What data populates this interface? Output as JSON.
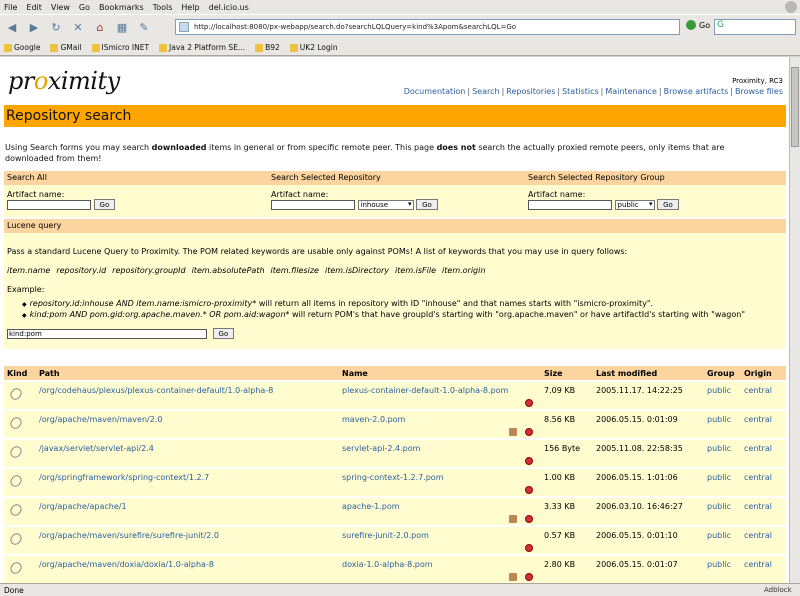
{
  "browser": {
    "menu": [
      "File",
      "Edit",
      "View",
      "Go",
      "Bookmarks",
      "Tools",
      "Help",
      "del.icio.us"
    ],
    "url": "http://localhost:8080/px-webapp/search.do?searchLQLQuery=kind%3Apom&searchLQL=Go",
    "go_label": "Go",
    "search_value": "G",
    "bookmarks": [
      "Google",
      "GMail",
      "ISmicro INET",
      "Java 2 Platform SE...",
      "B92",
      "UK2 Login"
    ],
    "status": "Done",
    "adblock": "Adblock"
  },
  "header": {
    "logo": "proximity",
    "version": "Proximity, RC3",
    "nav": [
      "Documentation",
      "Search",
      "Repositories",
      "Statistics",
      "Maintenance",
      "Browse artifacts",
      "Browse files"
    ]
  },
  "page": {
    "title": "Repository search",
    "intro_parts": [
      "Using Search forms you may search ",
      "downloaded",
      " items in general or from specific remote peer. This page ",
      "does not",
      " search the actually proxied remote peers, only items that are downloaded from them!"
    ]
  },
  "search_all": {
    "head": "Search All",
    "label": "Artifact name:",
    "button": "Go"
  },
  "search_repo": {
    "head": "Search Selected Repository",
    "label": "Artifact name:",
    "select": "inhouse",
    "button": "Go"
  },
  "search_group": {
    "head": "Search Selected Repository Group",
    "label": "Artifact name:",
    "select": "public",
    "button": "Go"
  },
  "lucene": {
    "head": "Lucene query",
    "description": "Pass a standard Lucene Query to Proximity. The POM related keywords are usable only against POMs! A list of keywords that you may use in query follows:",
    "keywords": [
      "item.name",
      "repository.id",
      "repository.groupId",
      "item.absolutePath",
      "item.filesize",
      "item.isDirectory",
      "item.isFile",
      "item.origin"
    ],
    "example_label": "Example:",
    "examples": [
      {
        "query": "repository.id:inhouse AND item.name:ismicro-proximity*",
        "desc": " will return all items in repository with ID \"inhouse\" and that names starts with \"ismicro-proximity\"."
      },
      {
        "query": "kind:pom AND pom.gid:org.apache.maven.* OR pom.aid:wagon*",
        "desc": " will return POM's that have groupId's starting with \"org.apache.maven\" or have artifactId's starting with \"wagon\""
      }
    ],
    "query_value": "kind:pom",
    "button": "Go"
  },
  "results": {
    "columns": [
      "Kind",
      "Path",
      "Name",
      "Size",
      "Last modified",
      "Group",
      "Origin"
    ],
    "rows": [
      {
        "path": "/org/codehaus/plexus/plexus-container-default/1.0-alpha-8",
        "name": "plexus-container-default-1.0-alpha-8.pom",
        "size": "7.09 KB",
        "modified": "2005.11.17. 14:22:25",
        "group": "public",
        "origin": "central",
        "home": false
      },
      {
        "path": "/org/apache/maven/maven/2.0",
        "name": "maven-2.0.pom",
        "size": "8.56 KB",
        "modified": "2006.05.15. 0:01:09",
        "group": "public",
        "origin": "central",
        "home": true
      },
      {
        "path": "/javax/servlet/servlet-api/2.4",
        "name": "servlet-api-2.4.pom",
        "size": "156 Byte",
        "modified": "2005.11.08. 22:58:35",
        "group": "public",
        "origin": "central",
        "home": false
      },
      {
        "path": "/org/springframework/spring-context/1.2.7",
        "name": "spring-context-1.2.7.pom",
        "size": "1.00 KB",
        "modified": "2006.05.15. 1:01:06",
        "group": "public",
        "origin": "central",
        "home": false
      },
      {
        "path": "/org/apache/apache/1",
        "name": "apache-1.pom",
        "size": "3.33 KB",
        "modified": "2006.03.10. 16:46:27",
        "group": "public",
        "origin": "central",
        "home": true
      },
      {
        "path": "/org/apache/maven/surefire/surefire-junit/2.0",
        "name": "surefire-junit-2.0.pom",
        "size": "0.57 KB",
        "modified": "2006.05.15. 0:01:10",
        "group": "public",
        "origin": "central",
        "home": false
      },
      {
        "path": "/org/apache/maven/doxia/doxia/1.0-alpha-8",
        "name": "doxia-1.0-alpha-8.pom",
        "size": "2.80 KB",
        "modified": "2006.05.15. 0:01:07",
        "group": "public",
        "origin": "central",
        "home": true
      }
    ]
  }
}
